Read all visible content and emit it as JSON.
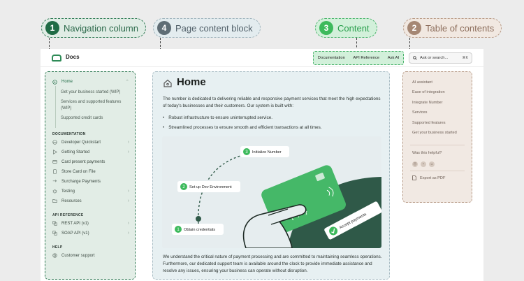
{
  "callouts": {
    "nav": {
      "num": "1",
      "label": "Navigation column"
    },
    "page": {
      "num": "4",
      "label": "Page content block"
    },
    "content": {
      "num": "3",
      "label": "Content"
    },
    "toc": {
      "num": "2",
      "label": "Table of contents"
    }
  },
  "topbar": {
    "brand": "Docs",
    "links": [
      "Documentation",
      "API Reference",
      "Ask AI"
    ],
    "search_placeholder": "Ask or search...",
    "search_shortcut": "⌘K"
  },
  "sidebar": {
    "home": "Home",
    "home_children": [
      "Get your business started (WIP)",
      "Services and supported features (WIP)",
      "Supported credit cards"
    ],
    "sections": [
      {
        "title": "DOCUMENTATION",
        "items": [
          {
            "label": "Developer Quickstart",
            "icon": "globe-icon",
            "chevron": true
          },
          {
            "label": "Getting Started",
            "icon": "play-icon",
            "chevron": true
          },
          {
            "label": "Card present payments",
            "icon": "card-icon",
            "chevron": false
          },
          {
            "label": "Store Card on File",
            "icon": "file-icon",
            "chevron": false
          },
          {
            "label": "Surcharge Payments",
            "icon": "arrows-icon",
            "chevron": false
          },
          {
            "label": "Testing",
            "icon": "bug-icon",
            "chevron": true
          },
          {
            "label": "Resources",
            "icon": "folder-icon",
            "chevron": true
          }
        ]
      },
      {
        "title": "API REFERENCE",
        "items": [
          {
            "label": "REST API (v1)",
            "icon": "api-icon",
            "chevron": true
          },
          {
            "label": "SOAP API (v1)",
            "icon": "api-icon",
            "chevron": true
          }
        ]
      },
      {
        "title": "HELP",
        "items": [
          {
            "label": "Customer support",
            "icon": "support-icon",
            "chevron": false
          }
        ]
      }
    ]
  },
  "main": {
    "title": "Home",
    "intro": "The number is dedicated to delivering reliable and responsive payment services that meet the high expectations of today's businesses and their customers. Our system is built with:",
    "bullets": [
      "Robust infrastructure to ensure uninterrupted service.",
      "Streamlined processes to ensure smooth and efficient transactions at all times."
    ],
    "steps": [
      {
        "num": "1",
        "label": "Obtain credentials"
      },
      {
        "num": "2",
        "label": "Set up Dev Environment"
      },
      {
        "num": "3",
        "label": "Initialize Number"
      }
    ],
    "badge": "Accept payments",
    "outro": "We understand the critical nature of payment processing and are committed to maintaining seamless operations. Furthermore, our dedicated support team is available around the clock to provide immediate assistance and resolve any issues, ensuring your business can operate without disruption."
  },
  "toc": {
    "items": [
      "AI assistant",
      "Ease of integration",
      "Integrate Number",
      "Services",
      "Supported features",
      "Get your business started"
    ],
    "helpful": "Was this helpful?",
    "export": "Export as PDF"
  },
  "colors": {
    "brand_green": "#2e8b57",
    "content_green": "#3dba5c",
    "card_green": "#45b868"
  }
}
